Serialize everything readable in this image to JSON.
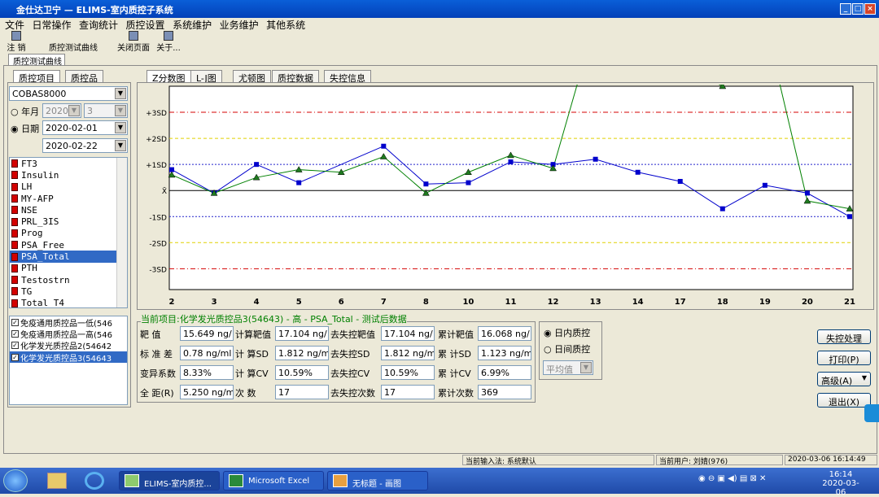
{
  "window": {
    "title": "金仕达卫宁 — ELIMS-室内质控子系统"
  },
  "menu": [
    "文件",
    "日常操作",
    "查询统计",
    "质控设置",
    "系统维护",
    "业务维护",
    "其他系统"
  ],
  "toolbar": {
    "logout": "注  销",
    "qc_curve": "质控测试曲线",
    "close_page": "关闭页面",
    "about": "关于..."
  },
  "doc_tab": "质控测试曲线",
  "left_tabs": [
    "质控项目",
    "质控品"
  ],
  "instrument": "COBAS8000",
  "filter": {
    "year_label": "年月",
    "year": "2020",
    "month": "3",
    "day_label": "日期",
    "date_from": "2020-02-01",
    "date_to": "2020-02-22"
  },
  "items": [
    "FT3",
    "Insulin",
    "LH",
    "MY-AFP",
    "NSE",
    "PRL_3IS",
    "Prog",
    "PSA_Free",
    "PSA_Total",
    "PTH",
    "Testostrn",
    "TG",
    "Total_T4"
  ],
  "selected_item": "PSA_Total",
  "qc_materials": [
    "免疫通用质控品一低(546",
    "免疫通用质控品一高(546",
    "化学发光质控品2(54642",
    "化学发光质控品3(54643"
  ],
  "chart_tabs": [
    "Z分数图",
    "L-J图",
    "尤顿图",
    "质控数据",
    "失控信息"
  ],
  "chart_data": {
    "type": "line",
    "x": [
      "2",
      "3",
      "4",
      "5",
      "6",
      "7",
      "8",
      "10",
      "11",
      "12",
      "13",
      "14",
      "17",
      "18",
      "19",
      "20",
      "21"
    ],
    "y_labels": [
      "+3SD",
      "+2SD",
      "+1SD",
      "X̄",
      "-1SD",
      "-2SD",
      "-3SD"
    ],
    "ylim": [
      -3.8,
      4.0
    ],
    "series": [
      {
        "color": "#0000cc",
        "marker": "square",
        "values": [
          0.8,
          -0.1,
          1.0,
          0.3,
          null,
          1.7,
          0.25,
          0.3,
          1.1,
          1.0,
          1.2,
          0.7,
          0.35,
          -0.7,
          0.2,
          -0.1,
          -1.0
        ]
      },
      {
        "color": "#008000",
        "marker": "triangle",
        "values": [
          0.6,
          -0.1,
          0.5,
          0.8,
          0.7,
          1.3,
          -0.1,
          0.7,
          1.35,
          0.85,
          6.5,
          null,
          null,
          4.0,
          6.5,
          -0.4,
          -0.7
        ]
      }
    ]
  },
  "summary": {
    "caption": "当前项目:化学发光质控品3(54643) - 高 - PSA_Total - 测试后数据",
    "target_label": "靶    值",
    "target": "15.649 ng/",
    "calc_target_label": "计算靶值",
    "calc_target": "17.104 ng/",
    "oc_target_label": "去失控靶值",
    "oc_target": "17.104 ng/",
    "cum_target_label": "累计靶值",
    "cum_target": "16.068 ng/",
    "sd_label": "标 准 差",
    "sd": "0.78 ng/ml",
    "calc_sd_label": "计 算SD",
    "calc_sd": "1.812 ng/m",
    "oc_sd_label": "去失控SD",
    "oc_sd": "1.812 ng/m",
    "cum_sd_label": "累 计SD",
    "cum_sd": "1.123 ng/m",
    "cv_label": "变异系数",
    "cv": "8.33%",
    "calc_cv_label": "计 算CV",
    "calc_cv": "10.59%",
    "oc_cv_label": "去失控CV",
    "oc_cv": "10.59%",
    "cum_cv_label": "累 计CV",
    "cum_cv": "6.99%",
    "range_label": "全 距(R)",
    "range": "5.250 ng/m",
    "count_label": "次    数",
    "count": "17",
    "oc_count_label": "去失控次数",
    "oc_count": "17",
    "cum_count_label": "累计次数",
    "cum_count": "369"
  },
  "qc_mode": {
    "intra": "日内质控",
    "inter": "日间质控",
    "avg": "平均值"
  },
  "buttons": {
    "outcontrol": "失控处理",
    "print": "打印(P)",
    "advanced": "高级(A)",
    "exit": "退出(X)"
  },
  "status": {
    "input_method": "当前输入法: 系统默认",
    "user": "当前用户: 刘婧(976)",
    "datetime": "2020-03-06  16:14:49"
  },
  "taskbar": {
    "tasks": [
      "ELIMS-室内质控...",
      "Microsoft Excel",
      "无标题 - 画图"
    ],
    "time": "16:14",
    "date": "2020-03-06"
  }
}
